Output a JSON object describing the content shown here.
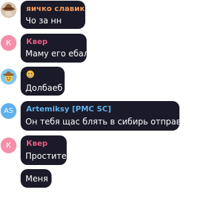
{
  "messages": [
    {
      "sender": "яичко славик",
      "sender_color": "#f29a5a",
      "text": "Чо за нн",
      "avatar": {
        "type": "photo",
        "icon": "cowboy-hat-photo-icon"
      }
    },
    {
      "sender": "Квер",
      "sender_color": "#e85d84",
      "text": "Маму его ебал",
      "avatar": {
        "type": "letter",
        "label": "К",
        "color": "#f58ea8"
      }
    },
    {
      "sender": "",
      "text": "Долбаеб",
      "emoji": "grimace-emoji-icon",
      "avatar": {
        "type": "photo",
        "icon": "cowboy-hat-face-icon"
      }
    },
    {
      "sender": "Artemiksy [PMC SC]",
      "sender_color": "#5eb1ed",
      "text": "Он тебя щас блять в сибирь отправит",
      "avatar": {
        "type": "letter",
        "label": "AS",
        "color": "#5eb1ed"
      }
    },
    {
      "sender": "Квер",
      "sender_color": "#e85d84",
      "text": "Простите",
      "avatar": {
        "type": "letter",
        "label": "К",
        "color": "#f58ea8"
      }
    },
    {
      "sender": "",
      "text": "Меня"
    }
  ]
}
